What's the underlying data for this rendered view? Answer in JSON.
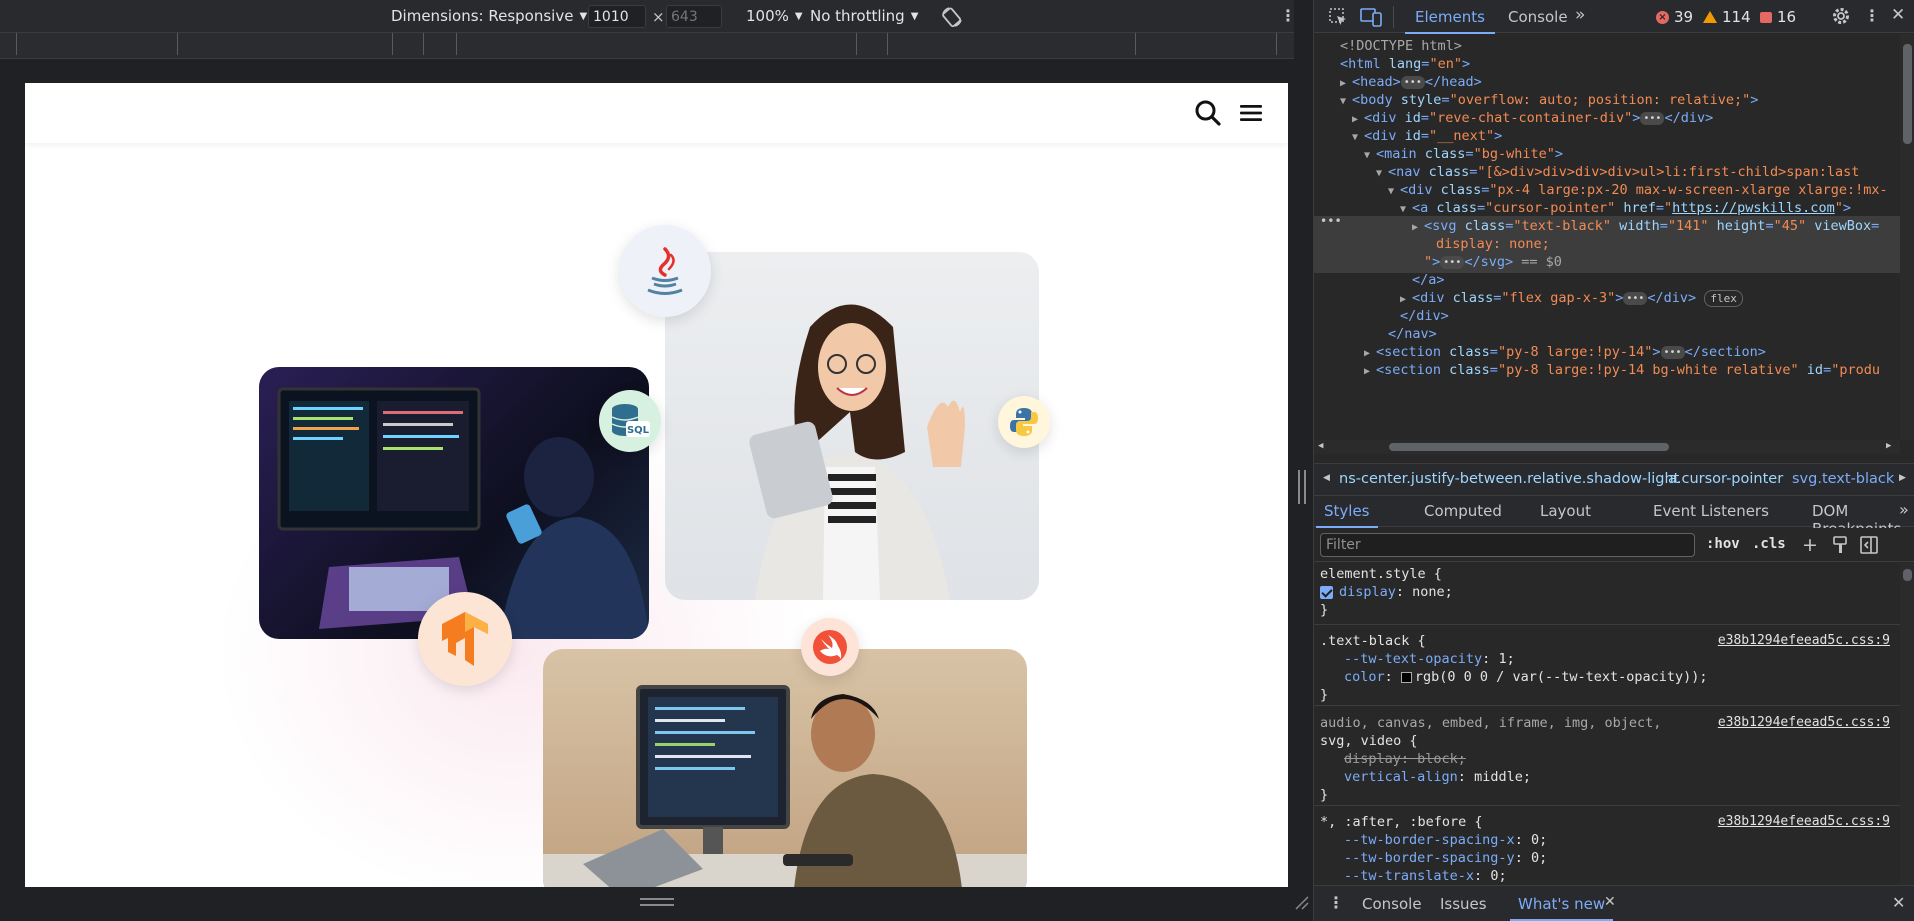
{
  "device_toolbar": {
    "dimensions_label": "Dimensions: Responsive",
    "width_value": "1010",
    "height_placeholder": "643",
    "times": "×",
    "zoom": "100%",
    "throttling": "No throttling"
  },
  "devtools": {
    "tabs": [
      "Elements",
      "Console"
    ],
    "more_tabs": "»",
    "error_count": "39",
    "warning_count": "114",
    "issue_count": "16",
    "dom_lines": [
      {
        "tokens": [
          {
            "c": "gr",
            "t": "<!DOCTYPE html>"
          }
        ]
      },
      {
        "tokens": [
          {
            "c": "t",
            "t": "<html "
          },
          {
            "c": "an",
            "t": "lang"
          },
          {
            "c": "t",
            "t": "="
          },
          {
            "c": "av",
            "t": "\"en\""
          },
          {
            "c": "t",
            "t": ">"
          }
        ]
      },
      {
        "tokens": [
          {
            "c": "t",
            "t": "<head>"
          },
          {
            "c": "dots",
            "t": "•••"
          },
          {
            "c": "t",
            "t": "</head>"
          }
        ]
      },
      {
        "tokens": [
          {
            "c": "t",
            "t": "<body "
          },
          {
            "c": "an",
            "t": "style"
          },
          {
            "c": "t",
            "t": "="
          },
          {
            "c": "av",
            "t": "\"overflow: auto; position: relative;\""
          },
          {
            "c": "t",
            "t": ">"
          }
        ]
      },
      {
        "tokens": [
          {
            "c": "t",
            "t": "<div "
          },
          {
            "c": "an",
            "t": "id"
          },
          {
            "c": "t",
            "t": "="
          },
          {
            "c": "av",
            "t": "\"reve-chat-container-div\""
          },
          {
            "c": "t",
            "t": ">"
          },
          {
            "c": "dots",
            "t": "•••"
          },
          {
            "c": "t",
            "t": "</div>"
          }
        ]
      },
      {
        "tokens": [
          {
            "c": "t",
            "t": "<div "
          },
          {
            "c": "an",
            "t": "id"
          },
          {
            "c": "t",
            "t": "="
          },
          {
            "c": "av",
            "t": "\"__next\""
          },
          {
            "c": "t",
            "t": ">"
          }
        ]
      },
      {
        "tokens": [
          {
            "c": "t",
            "t": "<main "
          },
          {
            "c": "an",
            "t": "class"
          },
          {
            "c": "t",
            "t": "="
          },
          {
            "c": "av",
            "t": "\"bg-white\""
          },
          {
            "c": "t",
            "t": ">"
          }
        ]
      },
      {
        "tokens": [
          {
            "c": "t",
            "t": "<nav "
          },
          {
            "c": "an",
            "t": "class"
          },
          {
            "c": "t",
            "t": "="
          },
          {
            "c": "av",
            "t": "\"[&>div>div>div>div>ul>li:first-child>span:last"
          }
        ]
      },
      {
        "tokens": [
          {
            "c": "t",
            "t": "<div "
          },
          {
            "c": "an",
            "t": "class"
          },
          {
            "c": "t",
            "t": "="
          },
          {
            "c": "av",
            "t": "\"px-4 large:px-20 max-w-screen-xlarge xlarge:!mx-"
          }
        ]
      },
      {
        "tokens": [
          {
            "c": "t",
            "t": "<a "
          },
          {
            "c": "an",
            "t": "class"
          },
          {
            "c": "t",
            "t": "="
          },
          {
            "c": "av",
            "t": "\"cursor-pointer\" "
          },
          {
            "c": "an",
            "t": "href"
          },
          {
            "c": "t",
            "t": "="
          },
          {
            "c": "av",
            "t": "\""
          },
          {
            "c": "av link",
            "t": "https://pwskills.com"
          },
          {
            "c": "av",
            "t": "\""
          },
          {
            "c": "t",
            "t": ">"
          }
        ]
      },
      {
        "tokens": [
          {
            "c": "t",
            "t": "<svg "
          },
          {
            "c": "an",
            "t": "class"
          },
          {
            "c": "t",
            "t": "="
          },
          {
            "c": "av",
            "t": "\"text-black\" "
          },
          {
            "c": "an",
            "t": "width"
          },
          {
            "c": "t",
            "t": "="
          },
          {
            "c": "av",
            "t": "\"141\" "
          },
          {
            "c": "an",
            "t": "height"
          },
          {
            "c": "t",
            "t": "="
          },
          {
            "c": "av",
            "t": "\"45\" "
          },
          {
            "c": "an",
            "t": "viewBox"
          },
          {
            "c": "t",
            "t": "="
          }
        ]
      },
      {
        "tokens": [
          {
            "c": "av",
            "t": "display: none;"
          }
        ]
      },
      {
        "tokens": [
          {
            "c": "av",
            "t": "\""
          },
          {
            "c": "t",
            "t": ">"
          },
          {
            "c": "dots",
            "t": "•••"
          },
          {
            "c": "t",
            "t": "</svg>"
          },
          {
            "c": "gr",
            "t": " == $0"
          }
        ]
      },
      {
        "tokens": [
          {
            "c": "t",
            "t": "</a>"
          }
        ]
      },
      {
        "tokens": [
          {
            "c": "t",
            "t": "<div "
          },
          {
            "c": "an",
            "t": "class"
          },
          {
            "c": "t",
            "t": "="
          },
          {
            "c": "av",
            "t": "\"flex gap-x-3\""
          },
          {
            "c": "t",
            "t": ">"
          },
          {
            "c": "dots",
            "t": "•••"
          },
          {
            "c": "t",
            "t": "</div> "
          },
          {
            "c": "pill",
            "t": "flex"
          }
        ]
      },
      {
        "tokens": [
          {
            "c": "t",
            "t": "</div>"
          }
        ]
      },
      {
        "tokens": [
          {
            "c": "t",
            "t": "</nav>"
          }
        ]
      },
      {
        "tokens": [
          {
            "c": "t",
            "t": "<section "
          },
          {
            "c": "an",
            "t": "class"
          },
          {
            "c": "t",
            "t": "="
          },
          {
            "c": "av",
            "t": "\"py-8 large:!py-14\""
          },
          {
            "c": "t",
            "t": ">"
          },
          {
            "c": "dots",
            "t": "•••"
          },
          {
            "c": "t",
            "t": "</section>"
          }
        ]
      },
      {
        "tokens": [
          {
            "c": "t",
            "t": "<section "
          },
          {
            "c": "an",
            "t": "class"
          },
          {
            "c": "t",
            "t": "="
          },
          {
            "c": "av",
            "t": "\"py-8 large:!py-14 bg-white relative\" "
          },
          {
            "c": "an",
            "t": "id"
          },
          {
            "c": "t",
            "t": "="
          },
          {
            "c": "av",
            "t": "\"produ"
          }
        ]
      }
    ],
    "breadcrumbs": [
      "ns-center.justify-between.relative.shadow-light",
      "a.cursor-pointer",
      "svg.text-black"
    ],
    "subtabs": [
      "Styles",
      "Computed",
      "Layout",
      "Event Listeners",
      "DOM Breakpoints"
    ],
    "filter_placeholder": "Filter",
    "hov": ":hov",
    "cls": ".cls",
    "styles": {
      "element_style": {
        "selector": "element.style {",
        "prop": "display",
        "value": "none;",
        "close": "}"
      },
      "text_black": {
        "selector": ".text-black {",
        "source": "e38b1294efeead5c.css:9",
        "p1": "--tw-text-opacity",
        "v1": "1;",
        "p2": "color",
        "v2": "rgb(0 0 0 / var(--tw-text-opacity));",
        "close": "}"
      },
      "media": {
        "selector1": "audio, canvas, embed, iframe, img, object,",
        "selector2": "svg, video {",
        "source": "e38b1294efeead5c.css:9",
        "p1": "display: block;",
        "p2": "vertical-align",
        "v2": "middle;",
        "close": "}"
      },
      "universal": {
        "selector": "*, :after, :before {",
        "source": "e38b1294efeead5c.css:9",
        "p1": "--tw-border-spacing-x",
        "v1": "0;",
        "p2": "--tw-border-spacing-y",
        "v2": "0;",
        "p3": "--tw-translate-x",
        "v3": "0;"
      }
    },
    "drawer_tabs": [
      "Console",
      "Issues",
      "What's new"
    ]
  },
  "colors": {
    "accent": "#7cacf8",
    "error": "#e46962",
    "warning": "#f29900"
  }
}
